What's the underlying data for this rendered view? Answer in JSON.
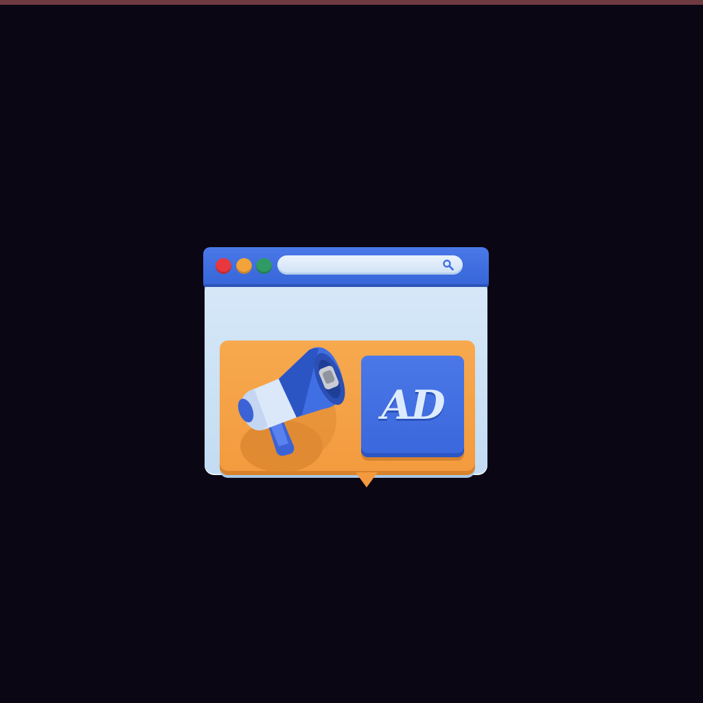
{
  "illustration": {
    "ad_label": "AD",
    "icons": {
      "close": "red-window-dot",
      "minimize": "yellow-window-dot",
      "maximize": "green-window-dot",
      "search": "search-icon",
      "megaphone": "megaphone-icon"
    },
    "colors": {
      "background": "#0b0614",
      "window_bar": "#3f6fe3",
      "window_body": "#cfe2f6",
      "panel": "#f4a045",
      "badge": "#3f6fe3",
      "dot_red": "#e8383e",
      "dot_yellow": "#f2a33a",
      "dot_green": "#2f9a63"
    }
  }
}
